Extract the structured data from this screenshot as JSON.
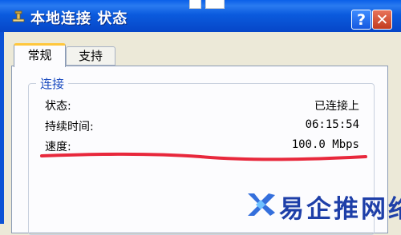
{
  "window": {
    "title": "本地连接 状态",
    "help_label": "?",
    "close_label": "✕"
  },
  "tabs": [
    {
      "label": "常规",
      "active": true
    },
    {
      "label": "支持",
      "active": false
    }
  ],
  "connection_group": {
    "title": "连接",
    "rows": [
      {
        "label": "状态:",
        "value": "已连接上"
      },
      {
        "label": "持续时间:",
        "value": "06:15:54"
      },
      {
        "label": "速度:",
        "value": "100.0 Mbps"
      }
    ]
  },
  "annotation": {
    "color": "#E8283C"
  },
  "watermark": {
    "text": "易企推网络",
    "color": "#1E3FA8"
  },
  "colors": {
    "titlebar": "#0B5BDE",
    "dialog": "#ECE9D8",
    "accent": "#1B4BBF"
  }
}
